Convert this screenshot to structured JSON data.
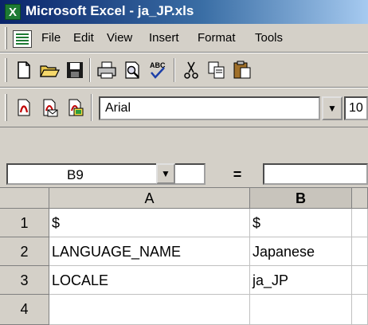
{
  "window": {
    "title": "Microsoft Excel - ja_JP.xls",
    "app_icon": "excel-icon"
  },
  "menu": {
    "items": [
      "File",
      "Edit",
      "View",
      "Insert",
      "Format",
      "Tools"
    ]
  },
  "standard_toolbar": {
    "buttons": [
      "new-icon",
      "open-icon",
      "save-icon",
      "print-icon",
      "print-preview-icon",
      "spelling-icon",
      "cut-icon",
      "copy-icon",
      "paste-icon"
    ]
  },
  "formatting_toolbar": {
    "font_name": "Arial",
    "font_size": "10",
    "buttons": [
      "convert-to-pdf-icon",
      "convert-to-pdf-email-icon",
      "pdf-review-icon"
    ]
  },
  "formula_bar": {
    "name_box": "B9",
    "equals": "=",
    "value": ""
  },
  "sheet": {
    "columns": [
      "A",
      "B"
    ],
    "rows": [
      {
        "num": "1",
        "a": "$",
        "b": "$"
      },
      {
        "num": "2",
        "a": "LANGUAGE_NAME",
        "b": "Japanese"
      },
      {
        "num": "3",
        "a": "LOCALE",
        "b": "ja_JP"
      },
      {
        "num": "4",
        "a": "",
        "b": ""
      }
    ]
  }
}
